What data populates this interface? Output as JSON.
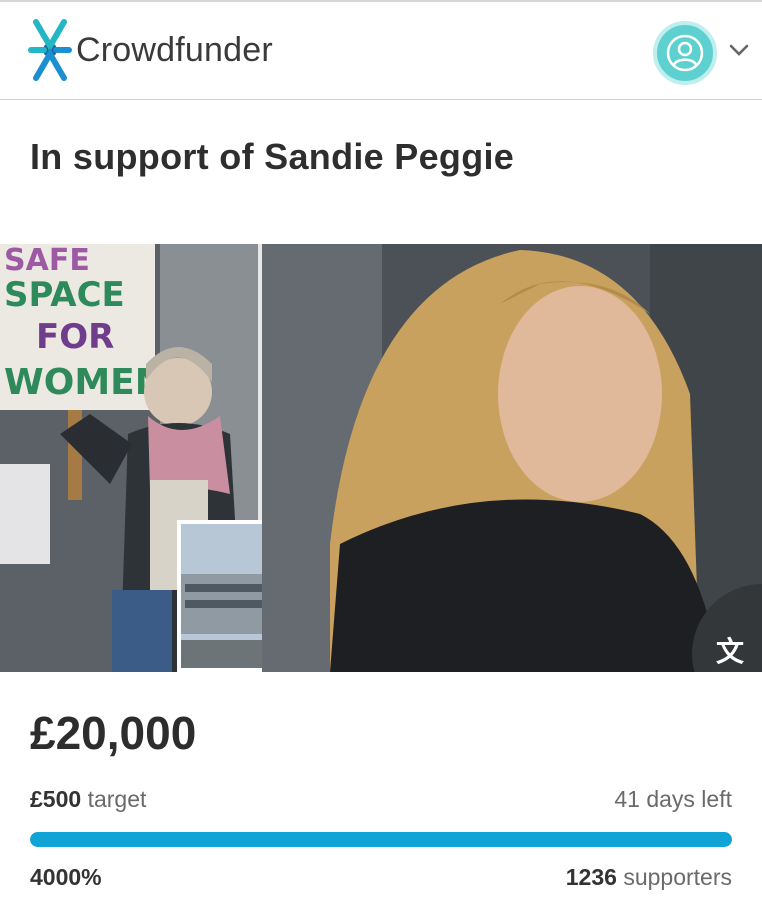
{
  "header": {
    "brand": "Crowdfunder",
    "logo_icon": "crowdfunder-logo-icon",
    "avatar_icon": "user-avatar-icon",
    "menu_icon": "chevron-down-icon"
  },
  "campaign": {
    "title": "In support of Sandie Peggie",
    "image": {
      "sign_lines": [
        "SAFE",
        "SPACE",
        "FOR",
        "WOMEN"
      ],
      "translate_icon": "translate-icon"
    },
    "raised": "£20,000",
    "target_amount": "£500",
    "target_label": "target",
    "days_left": "41 days left",
    "progress_label": "4000%",
    "progress_fraction": 1.0,
    "supporters_count": "1236",
    "supporters_label": "supporters"
  },
  "colors": {
    "brand_teal": "#23b6c4",
    "brand_blue": "#1c5f9c",
    "avatar_bg": "#5fd0d0",
    "progress": "#10a4d6"
  }
}
